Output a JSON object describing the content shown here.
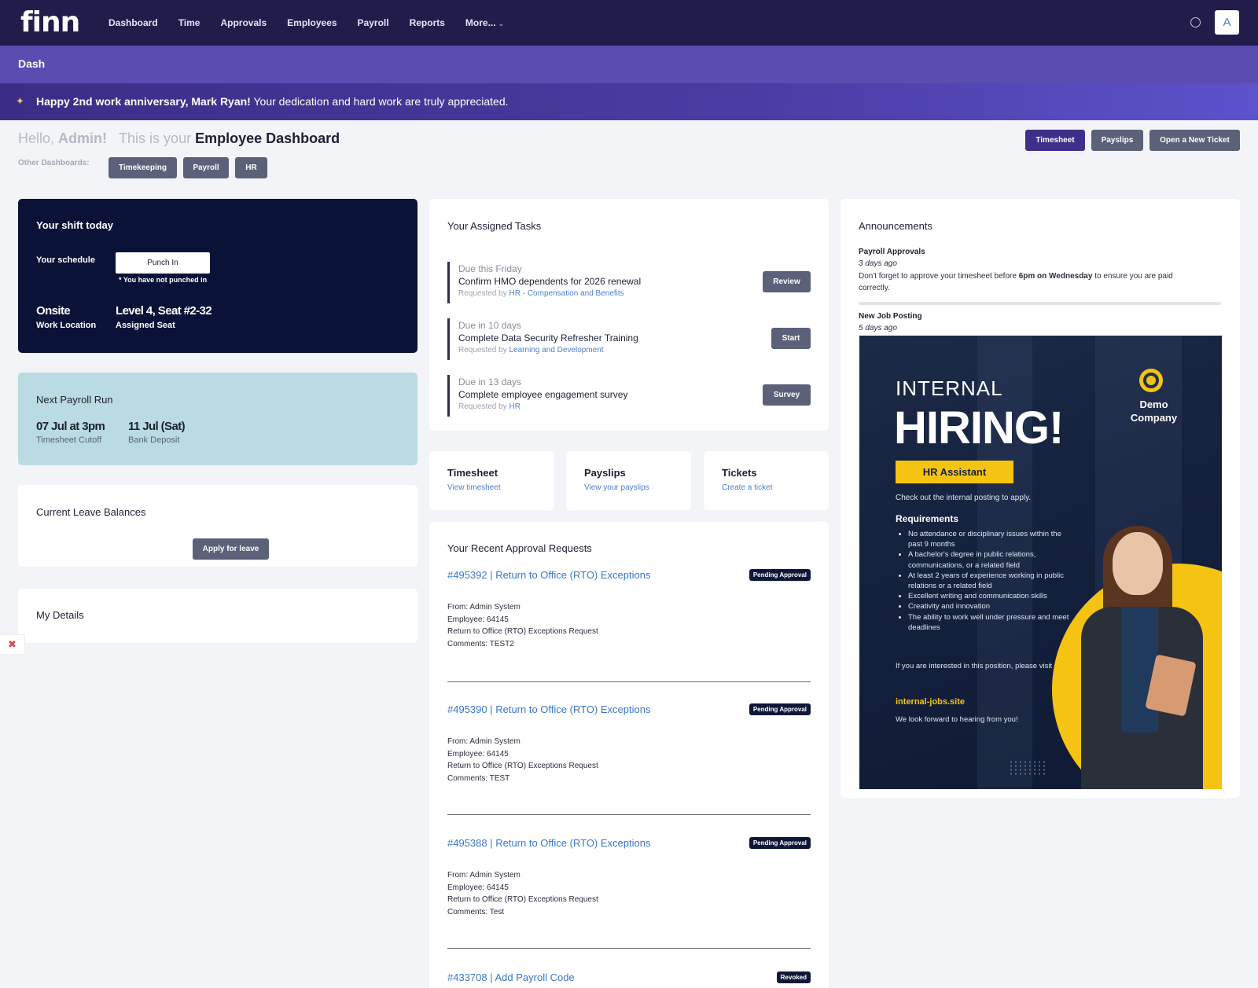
{
  "nav": {
    "logo": "finn",
    "links": [
      "Dashboard",
      "Time",
      "Approvals",
      "Employees",
      "Payroll",
      "Reports",
      "More..."
    ],
    "avatar": "A"
  },
  "dashbar": {
    "title": "Dash"
  },
  "banner": {
    "bold": "Happy 2nd work anniversary, Mark Ryan!",
    "text": " Your dedication and hard work are truly appreciated."
  },
  "greeting": {
    "hello": "Hello, ",
    "admin": "Admin!",
    "this_is": "This is your ",
    "dashboard": "Employee Dashboard",
    "other_label": "Other Dashboards:",
    "other_buttons": [
      "Timekeeping",
      "Payroll",
      "HR"
    ]
  },
  "top_buttons": [
    "Timesheet",
    "Payslips",
    "Open a New Ticket"
  ],
  "shift": {
    "title": "Your shift today",
    "schedule_label": "Your schedule",
    "punch_label": "Punch In",
    "not_punched": "* You have not punched in",
    "location_value": "Onsite",
    "location_label": "Work Location",
    "seat_value": "Level 4, Seat #2-32",
    "seat_label": "Assigned Seat"
  },
  "payroll_run": {
    "title": "Next Payroll Run",
    "cutoff_value": "07 Jul at 3pm",
    "cutoff_label": "Timesheet Cutoff",
    "deposit_value": "11 Jul (Sat)",
    "deposit_label": "Bank Deposit"
  },
  "leave": {
    "title": "Current Leave Balances",
    "apply_label": "Apply for leave"
  },
  "details": {
    "title": "My Details"
  },
  "tasks": {
    "title": "Your Assigned Tasks",
    "items": [
      {
        "due": "Due this Friday",
        "title": "Confirm HMO dependents for 2026 renewal",
        "req_prefix": "Requested by ",
        "req_by": "HR - Compensation and Benefits",
        "action": "Review"
      },
      {
        "due": "Due in 10 days",
        "title": "Complete Data Security Refresher Training",
        "req_prefix": "Requested by ",
        "req_by": "Learning and Development",
        "action": "Start"
      },
      {
        "due": "Due in 13 days",
        "title": "Complete employee engagement survey",
        "req_prefix": "Requested by ",
        "req_by": "HR",
        "action": "Survey"
      }
    ]
  },
  "shortcuts": [
    {
      "title": "Timesheet",
      "link": "View timesheet"
    },
    {
      "title": "Payslips",
      "link": "View your payslips"
    },
    {
      "title": "Tickets",
      "link": "Create a ticket"
    }
  ],
  "approvals": {
    "title": "Your Recent Approval Requests",
    "items": [
      {
        "link": "#495392 | Return to Office (RTO) Exceptions",
        "status": "Pending Approval",
        "from": "From: Admin System",
        "employee": "Employee: 64145",
        "type": "Return to Office (RTO) Exceptions Request",
        "comments": "Comments: TEST2"
      },
      {
        "link": "#495390 | Return to Office (RTO) Exceptions",
        "status": "Pending Approval",
        "from": "From: Admin System",
        "employee": "Employee: 64145",
        "type": "Return to Office (RTO) Exceptions Request",
        "comments": "Comments: TEST"
      },
      {
        "link": "#495388 | Return to Office (RTO) Exceptions",
        "status": "Pending Approval",
        "from": "From: Admin System",
        "employee": "Employee: 64145",
        "type": "Return to Office (RTO) Exceptions Request",
        "comments": "Comments: Test"
      },
      {
        "link": "#433708 | Add Payroll Code",
        "status": "Revoked"
      }
    ]
  },
  "announcements": {
    "title": "Announcements",
    "a1_title": "Payroll Approvals",
    "a1_ago": "3 days ago",
    "a1_text_1": "Don't forget to approve your timesheet before ",
    "a1_text_bold": "6pm on Wednesday",
    "a1_text_2": " to ensure you are paid correctly.",
    "a2_title": "New Job Posting",
    "a2_ago": "5 days ago"
  },
  "poster": {
    "internal": "INTERNAL",
    "hiring": "HIRING!",
    "company": "Demo Company",
    "role": "HR Assistant",
    "check": "Check out the internal posting to apply.",
    "requirements_title": "Requirements",
    "requirements": [
      "No attendance or disciplinary issues within the past 9 months",
      "A bachelor's degree in public relations, communications, or a related field",
      "At least 2 years of experience working in public relations or a related field",
      "Excellent writing and communication skills",
      "Creativity and innovation",
      "The ability to work well under pressure and meet deadlines"
    ],
    "interested": "If you are interested in this position, please visit",
    "site": "internal-jobs.site",
    "lookforward": "We look forward to hearing from you!"
  },
  "colors": {
    "nav_bg": "#221c4b",
    "dashbar_bg": "#5b4cb2",
    "primary_button": "#3d2f8a",
    "secondary_button": "#5b6178",
    "shift_card": "#0b1237",
    "payroll_card": "#b9dbe1",
    "link": "#3a77c9",
    "poster_accent": "#f5c412"
  }
}
